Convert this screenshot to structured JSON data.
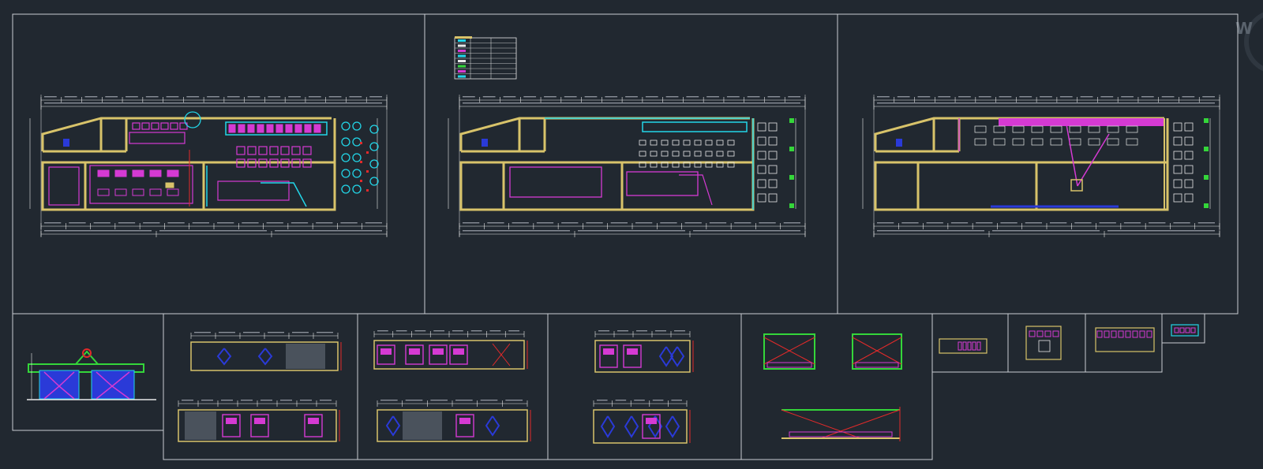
{
  "app": {
    "watermark": "W"
  },
  "colors": {
    "background": "#212830",
    "frame": "#c9cdd2",
    "wall": "#d8c36a",
    "furniture_magenta": "#d53ad3",
    "cyan": "#22d6e8",
    "green": "#34d63a",
    "red": "#e32a2a",
    "blue": "#2a3ad8",
    "white": "#e8e8e8",
    "gray": "#8a9099"
  },
  "icons": {
    "watermark": "watermark-logo-icon"
  }
}
